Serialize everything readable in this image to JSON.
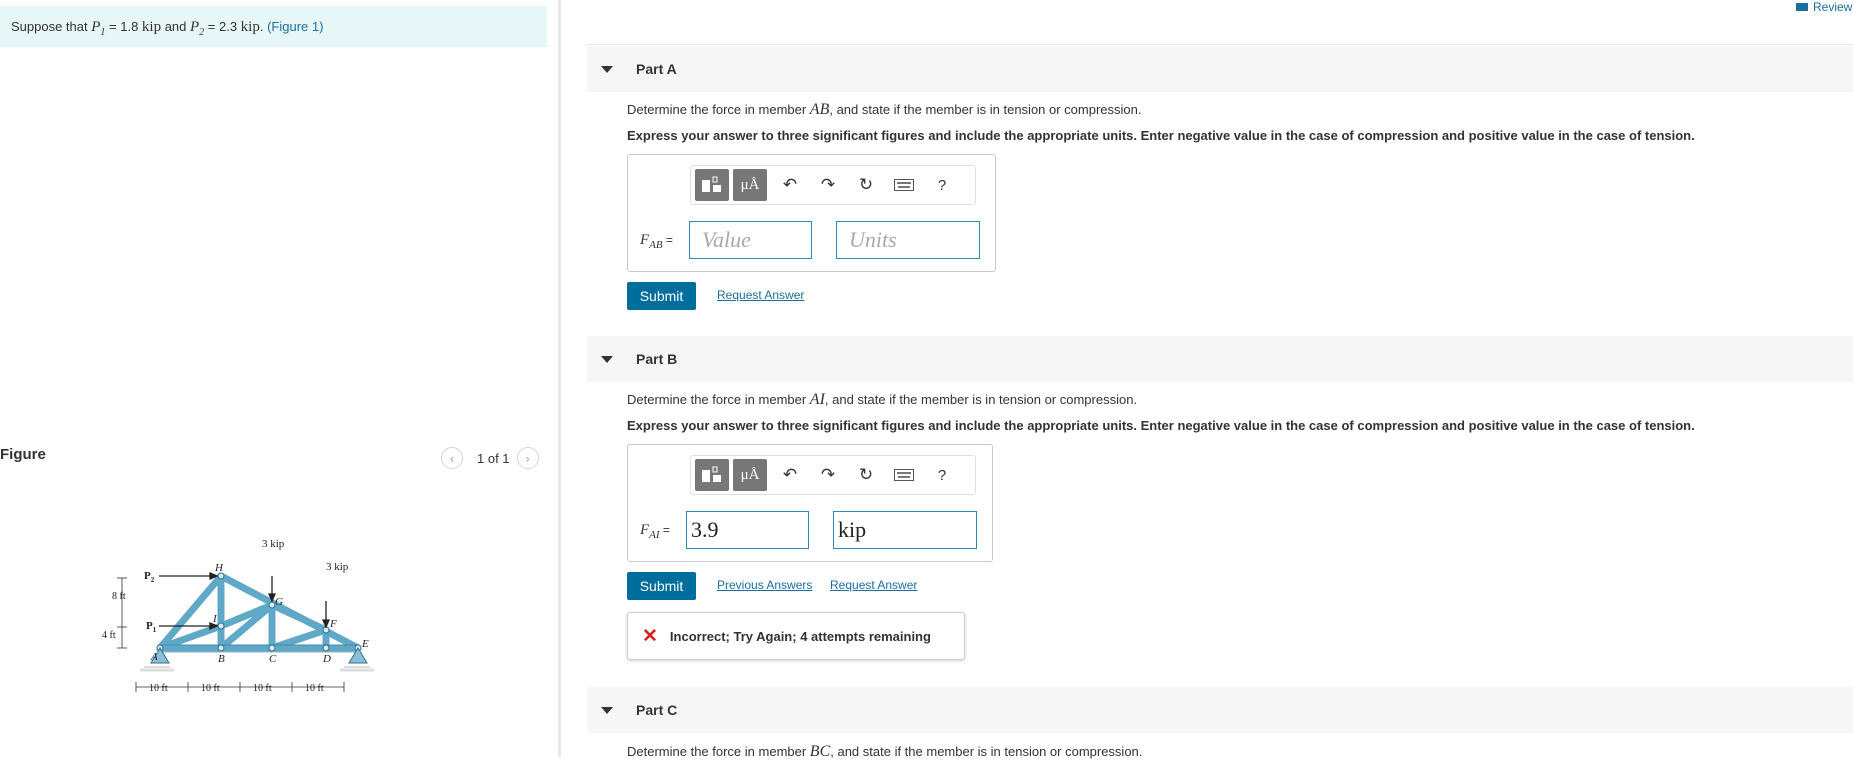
{
  "problem": {
    "prefix": "Suppose that ",
    "p1_symbol": "P",
    "p1_sub": "1",
    "p1_value": " = 1.8 ",
    "unit1": "kip",
    "and_text": " and ",
    "p2_symbol": "P",
    "p2_sub": "2",
    "p2_value": " = 2.3 ",
    "unit2": "kip",
    "period": ". ",
    "figure_link": "(Figure 1)"
  },
  "figure": {
    "title": "Figure",
    "pager": "1 of 1",
    "prev_icon": "chevron-left-icon",
    "next_icon": "chevron-right-icon",
    "labels": {
      "P2": "P",
      "P2_sub": "2",
      "P1": "P",
      "P1_sub": "1",
      "H": "H",
      "I": "I",
      "G": "G",
      "F": "F",
      "A": "A",
      "B": "B",
      "C": "C",
      "D": "D",
      "E": "E",
      "load_g": "3 kip",
      "load_f": "3 kip",
      "h8": "8 ft",
      "h4": "4 ft",
      "spans": [
        "10 ft",
        "10 ft",
        "10 ft",
        "10 ft"
      ]
    }
  },
  "review_link": "Review",
  "toolbar": {
    "templates_icon": "templates-icon",
    "units_label": "μÅ",
    "undo_icon": "undo-icon",
    "redo_icon": "redo-icon",
    "reset_icon": "reset-icon",
    "keyboard_icon": "keyboard-icon",
    "help_label": "?"
  },
  "parts": [
    {
      "title": "Part A",
      "prompt_pre": "Determine the force in member ",
      "member": "AB",
      "prompt_post": ", and state if the member is in tension or compression.",
      "instruction": "Express your answer to three significant figures and include the appropriate units. Enter negative value in the case of compression and positive value in the case of tension.",
      "var": "F",
      "var_sub": "AB",
      "eq": " =",
      "value_placeholder": "Value",
      "units_placeholder": "Units",
      "submit": "Submit",
      "request_answer": "Request Answer"
    },
    {
      "title": "Part B",
      "prompt_pre": "Determine the force in member ",
      "member": "AI",
      "prompt_post": ", and state if the member is in tension or compression.",
      "instruction": "Express your answer to three significant figures and include the appropriate units. Enter negative value in the case of compression and positive value in the case of tension.",
      "var": "F",
      "var_sub": "AI",
      "eq": " =",
      "value": "3.9",
      "units": "kip",
      "submit": "Submit",
      "previous_answers": "Previous Answers",
      "request_answer": "Request Answer",
      "feedback": "Incorrect; Try Again; 4 attempts remaining",
      "feedback_mark": "✕"
    },
    {
      "title": "Part C",
      "prompt_pre": "Determine the force in member ",
      "member": "BC",
      "prompt_post": ", and state if the member is in tension or compression."
    }
  ]
}
